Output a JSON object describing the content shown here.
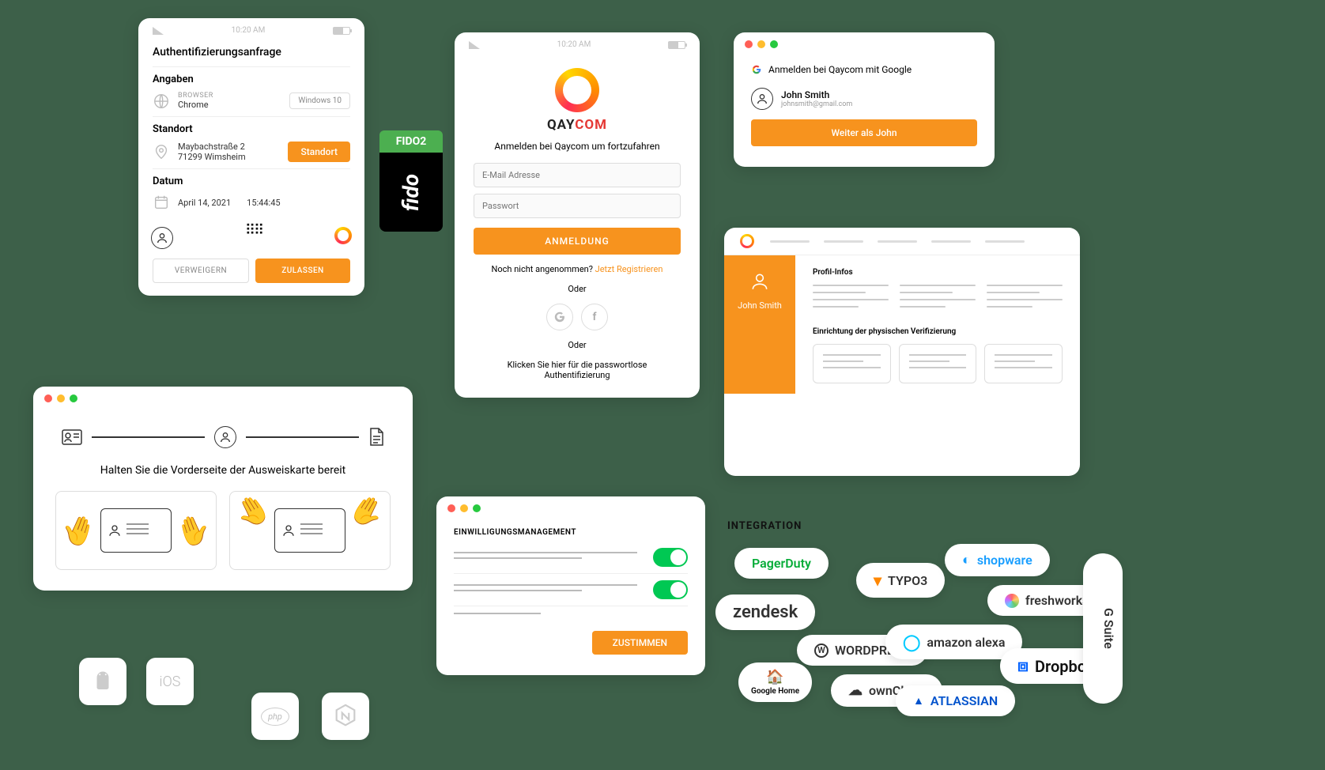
{
  "auth_req": {
    "status_time": "10:20 AM",
    "title": "Authentifizierungsanfrage",
    "details_label": "Angaben",
    "browser_label": "BROWSER",
    "browser_value": "Chrome",
    "os_tag": "Windows 10",
    "location_label": "Standort",
    "address_line1": "Maybachstraße 2",
    "address_line2": "71299 Wimsheim",
    "location_btn": "Standort",
    "date_label": "Datum",
    "date_value": "April 14, 2021",
    "time_value": "15:44:45",
    "deny": "VERWEIGERN",
    "allow": "ZULASSEN"
  },
  "fido": {
    "fido2": "FIDO2",
    "fido": "fido"
  },
  "login": {
    "status_time": "10:20 AM",
    "brand1": "QAY",
    "brand2": "COM",
    "subtitle": "Anmelden bei Qaycom um fortzufahren",
    "email_ph": "E-Mail Adresse",
    "pass_ph": "Passwort",
    "submit": "ANMELDUNG",
    "signup_q": "Noch nicht angenommen? ",
    "signup_link": "Jetzt Registrieren",
    "or": "Oder",
    "pwless": "Klicken Sie hier für die passwortlose Authentifizierung"
  },
  "google": {
    "title": "Anmelden bei Qaycom mit Google",
    "name": "John Smith",
    "email": "johnsmith@gmail.com",
    "continue": "Weiter als John"
  },
  "profile": {
    "name": "John Smith",
    "profile_infos": "Profil-Infos",
    "physical": "Einrichtung der physischen Verifizierung"
  },
  "idscan": {
    "headline": "Halten Sie die Vorderseite der Ausweiskarte bereit"
  },
  "consent": {
    "title": "EINWILLIGUNGSMANAGEMENT",
    "agree": "ZUSTIMMEN"
  },
  "platforms": {
    "android": "android",
    "ios": "iOS",
    "php": "php",
    "nodejs": "nodejs"
  },
  "integration": {
    "heading": "INTEGRATION",
    "brands": [
      "PagerDuty",
      "TYPO3",
      "shopware",
      "zendesk",
      "freshworks",
      "WORDPRESS",
      "amazon alexa",
      "Google Home",
      "ownCloud",
      "ATLASSIAN",
      "Dropbox",
      "G Suite"
    ]
  }
}
